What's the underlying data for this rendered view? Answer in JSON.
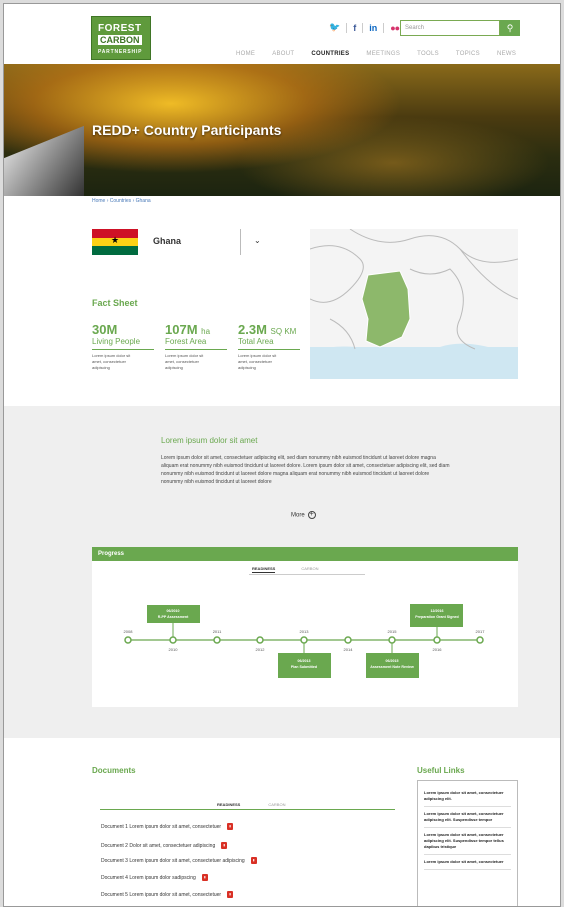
{
  "header": {
    "logo_line1": "FOREST",
    "logo_line2": "CARBON",
    "logo_line3": "PARTNERSHIP",
    "social": [
      "twitter-icon",
      "facebook-icon",
      "linkedin-icon",
      "flickr-icon"
    ],
    "search_placeholder": "Search",
    "nav": [
      "HOME",
      "ABOUT",
      "COUNTRIES",
      "MEETINGS",
      "TOOLS",
      "TOPICS",
      "NEWS"
    ],
    "nav_active": "COUNTRIES"
  },
  "hero": {
    "title": "REDD+ Country Participants"
  },
  "breadcrumb": "Home › Countries › Ghana",
  "country": {
    "name": "Ghana"
  },
  "fact_sheet": {
    "title": "Fact Sheet",
    "stats": [
      {
        "value": "30M",
        "unit": "",
        "label": "Living People",
        "desc": "Lorem ipsum dolor sit amet, consectetuer adipiscing"
      },
      {
        "value": "107M",
        "unit": "ha",
        "label": "Forest Area",
        "desc": "Lorem ipsum dolor sit amet, consectetuer adipiscing"
      },
      {
        "value": "2.3M",
        "unit": "SQ KM",
        "label": "Total Area",
        "desc": "Lorem ipsum dolor sit amet, consectetuer adipiscing"
      }
    ]
  },
  "intro": {
    "title": "Lorem ipsum dolor sit amet",
    "text": "Lorem ipsum dolor sit amet, consectetuer adipiscing elit, sed diam nonummy nibh euismod tincidunt ut laoreet dolore magna aliquam erat nonummy nibh euismod tincidunt ut laoreet dolore. Lorem ipsum dolor sit amet, consectetuer adipiscing elit, sed diam nonummy nibh euismod tincidunt ut laoreet dolore magna aliquam erat nonummy nibh euismod tincidunt ut laoreet dolore nonummy nibh euismod tincidunt ut laoreet dolore",
    "more_label": "More"
  },
  "progress": {
    "title": "Progress",
    "tabs": [
      "READINESS",
      "CARBON"
    ],
    "active_tab": "READINESS",
    "years_top": [
      "2008",
      "2011",
      "2013",
      "2015",
      "2017"
    ],
    "years_bottom": [
      "2010",
      "2012",
      "2014",
      "2016"
    ],
    "events": [
      {
        "date": "06/2010",
        "text": "R-PP Assessment"
      },
      {
        "date": "06/2013",
        "text": "Plan Submitted"
      },
      {
        "date": "06/2015",
        "text": "Assessment Note Review"
      },
      {
        "date": "12/2016",
        "text": "Preparation Grant Signed"
      }
    ]
  },
  "documents": {
    "title": "Documents",
    "tabs": [
      "READINESS",
      "CARBON"
    ],
    "items": [
      "Document 1  Lorem ipsum dolor sit amet, consectetuer",
      "Document 2  Dolor sit amet, consectetuer adipiscing",
      "Document 3  Lorem ipsum dolor sit amet, consectetuer adipiscing",
      "Document 4  Lorem ipsum dolor sadipscing",
      "Document 5  Lorem ipsum dolor sit amet, consectetuer"
    ]
  },
  "useful_links": {
    "title": "Useful Links",
    "items": [
      "Lorem ipsum dolor sit amet, consectetuer adipiscing elit.",
      "Lorem ipsum dolor sit amet, consectetuer adipiscing elit. Suspendisse tempor",
      "Lorem ipsum dolor sit amet, consectetuer adipiscing elit. Suspendisse tempor tellus dapibus tristique",
      "Lorem ipsum dolor sit amet, consectetuer"
    ]
  },
  "colors": {
    "brand_green": "#6aa84f",
    "map_highlight": "#8db86b",
    "water": "#cfe7f2"
  }
}
